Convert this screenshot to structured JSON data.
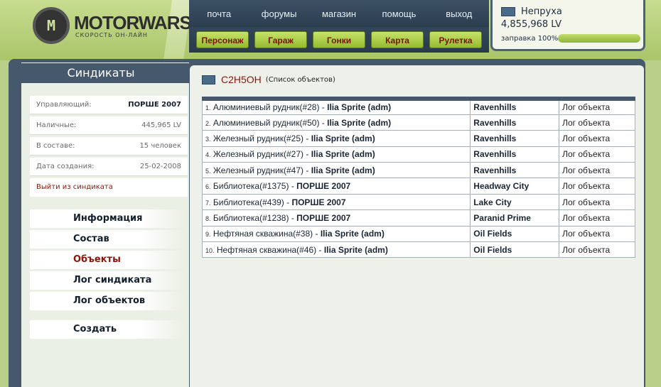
{
  "header": {
    "logo_title": "MOTORWARS.RU",
    "logo_sub": "СКОРОСТЬ ОН-ЛАЙН",
    "logo_mark": "M",
    "top_nav": [
      "почта",
      "форумы",
      "магазин",
      "помощь",
      "выход"
    ],
    "sub_nav": [
      "Персонаж",
      "Гараж",
      "Гонки",
      "Карта",
      "Рулетка"
    ]
  },
  "user": {
    "name": "Непруха",
    "money": "4,855,968 LV",
    "fuel_label": "заправка 100%",
    "fuel_percent": 100
  },
  "sidebar": {
    "title": "Синдикаты",
    "info": [
      {
        "label": "Управляющий:",
        "value": "ПОРШЕ 2007",
        "bold": true
      },
      {
        "label": "Наличные:",
        "value": "445,965 LV",
        "bold": false
      },
      {
        "label": "В составе:",
        "value": "15 человек",
        "bold": false
      },
      {
        "label": "Дата создания:",
        "value": "25-02-2008",
        "bold": false
      }
    ],
    "leave_link": "Выйти из синдиката",
    "menu": [
      "Информация",
      "Состав",
      "Объекты",
      "Лог синдиката",
      "Лог объектов"
    ],
    "create": "Создать"
  },
  "content": {
    "syndicate_name": "C2H5OH",
    "subtitle": "(Список объектов)",
    "rows": [
      {
        "num": "1.",
        "object": "Алюминиевый рудник(#28)",
        "owner": "Ilia Sprite (adm)",
        "city": "Ravenhills",
        "log": "Лог объекта"
      },
      {
        "num": "2.",
        "object": "Алюминиевый рудник(#50)",
        "owner": "Ilia Sprite (adm)",
        "city": "Ravenhills",
        "log": "Лог объекта"
      },
      {
        "num": "3.",
        "object": "Железный рудник(#25)",
        "owner": "Ilia Sprite (adm)",
        "city": "Ravenhills",
        "log": "Лог объекта"
      },
      {
        "num": "4.",
        "object": "Железный рудник(#27)",
        "owner": "Ilia Sprite (adm)",
        "city": "Ravenhills",
        "log": "Лог объекта"
      },
      {
        "num": "5.",
        "object": "Железный рудник(#47)",
        "owner": "Ilia Sprite (adm)",
        "city": "Ravenhills",
        "log": "Лог объекта"
      },
      {
        "num": "6.",
        "object": "Библиотека(#1375)",
        "owner": "ПОРШЕ 2007",
        "city": "Headway City",
        "log": "Лог объекта"
      },
      {
        "num": "7.",
        "object": "Библиотека(#439)",
        "owner": "ПОРШЕ 2007",
        "city": "Lake City",
        "log": "Лог объекта"
      },
      {
        "num": "8.",
        "object": "Библиотека(#1238)",
        "owner": "ПОРШЕ 2007",
        "city": "Paranid Prime",
        "log": "Лог объекта"
      },
      {
        "num": "9.",
        "object": "Нефтяная скважина(#38)",
        "owner": "Ilia Sprite (adm)",
        "city": "Oil Fields",
        "log": "Лог объекта"
      },
      {
        "num": "10.",
        "object": "Нефтяная скважина(#46)",
        "owner": "Ilia Sprite (adm)",
        "city": "Oil Fields",
        "log": "Лог объекта"
      }
    ]
  }
}
